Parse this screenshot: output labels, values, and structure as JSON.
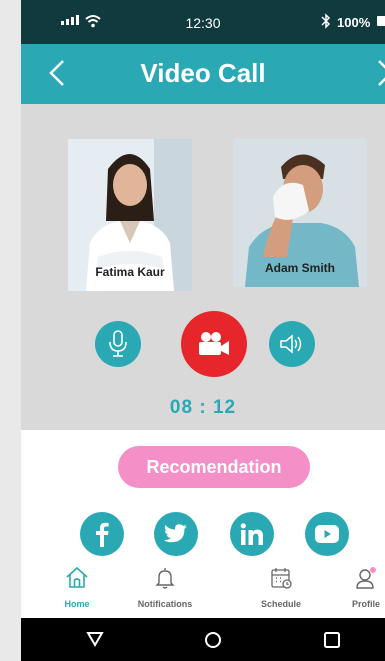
{
  "status_bar": {
    "time": "12:30",
    "battery": "100%"
  },
  "header": {
    "title": "Video Call"
  },
  "participants": [
    {
      "name": "Fatima Kaur"
    },
    {
      "name": "Adam Smith"
    }
  ],
  "call": {
    "timer": "08 : 12"
  },
  "recommendation_label": "Recomendation",
  "nav": {
    "home": "Home",
    "notifications": "Notifications",
    "schedule": "Schedule",
    "profile": "Profile"
  },
  "colors": {
    "teal": "#2aa9b5",
    "status_bar": "#103a3d",
    "end_call_red": "#e6262a",
    "pink": "#f48fc8",
    "call_bg": "#d9d9d9"
  }
}
